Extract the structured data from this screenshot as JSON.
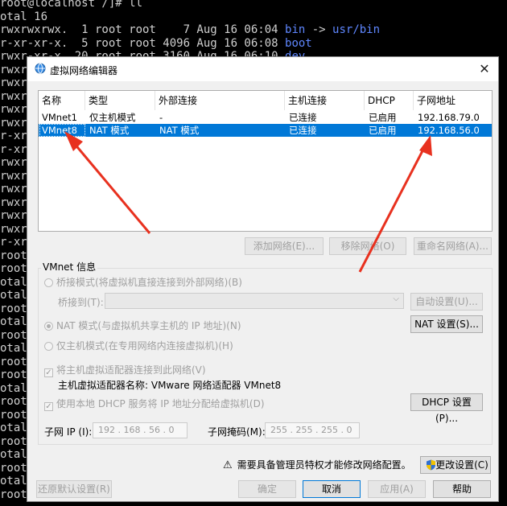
{
  "terminal": {
    "lines": [
      {
        "text": "root@localhost /]# ll"
      },
      {
        "text": "otal 16"
      },
      {
        "text": "rwxrwxrwx.  1 root root    7 Aug 16 06:04 ",
        "link": "bin",
        "arrow": " -> ",
        "target": "usr/bin"
      },
      {
        "text": "r-xr-xr-x.  5 root root 4096 Aug 16 06:08 ",
        "link": "boot"
      },
      {
        "text": "rwxr-xr-x. 20 root root 3160 Aug 16 06:10 ",
        "link": "dev"
      },
      {
        "text": "rwxr"
      },
      {
        "text": "rwxr"
      },
      {
        "text": "rwxr"
      },
      {
        "text": "rwxr"
      },
      {
        "text": "rwxr"
      },
      {
        "text": "r-xr"
      },
      {
        "text": "r-xr"
      },
      {
        "text": "rwxr"
      },
      {
        "text": "rwxr"
      },
      {
        "text": "rwxr"
      },
      {
        "text": "rwxrw"
      },
      {
        "text": "rwxr"
      },
      {
        "text": "rwxr"
      },
      {
        "text": "r-xr"
      },
      {
        "text": "root"
      },
      {
        "text": "root"
      },
      {
        "text": "otal"
      },
      {
        "text": "otal"
      },
      {
        "text": "root"
      },
      {
        "text": "otal"
      },
      {
        "text": "root"
      },
      {
        "text": "otal"
      },
      {
        "text": "root"
      },
      {
        "text": "root"
      },
      {
        "text": "otal"
      },
      {
        "text": "root"
      },
      {
        "text": "root"
      },
      {
        "text": "otal"
      },
      {
        "text": "root"
      },
      {
        "text": "otal"
      },
      {
        "text": "root"
      },
      {
        "text": "otal"
      },
      {
        "text": "root@localhost ~]#"
      }
    ]
  },
  "dialog": {
    "title": "虚拟网络编辑器",
    "close_glyph": "✕",
    "table": {
      "headers": [
        "名称",
        "类型",
        "外部连接",
        "主机连接",
        "DHCP",
        "子网地址"
      ],
      "rows": [
        [
          "VMnet1",
          "仅主机模式",
          "-",
          "已连接",
          "已启用",
          "192.168.79.0"
        ],
        [
          "VMnet8",
          "NAT 模式",
          "NAT 模式",
          "已连接",
          "已启用",
          "192.168.56.0"
        ]
      ],
      "selected_row": 1
    },
    "buttons": {
      "add_network": "添加网络(E)...",
      "remove_network": "移除网络(O)",
      "rename_network": "重命名网络(A)...",
      "auto_settings": "自动设置(U)...",
      "nat_settings": "NAT 设置(S)...",
      "dhcp_settings": "DHCP 设置(P)...",
      "change_settings": "更改设置(C)",
      "restore_defaults": "还原默认设置(R)",
      "ok": "确定",
      "cancel": "取消",
      "apply": "应用(A)",
      "help": "帮助"
    },
    "vmnet_info": {
      "label": "VMnet 信息",
      "bridge_mode": "桥接模式(将虚拟机直接连接到外部网络)(B)",
      "bridge_to_label": "桥接到(T):",
      "bridge_to_value": "",
      "nat_mode": "NAT 模式(与虚拟机共享主机的 IP 地址)(N)",
      "host_only_mode": "仅主机模式(在专用网络内连接虚拟机)(H)",
      "selected_mode": "nat",
      "connect_adapter": "将主机虚拟适配器连接到此网络(V)",
      "adapter_name_label": "主机虚拟适配器名称: VMware 网络适配器 VMnet8",
      "use_dhcp": "使用本地 DHCP 服务将 IP 地址分配给虚拟机(D)",
      "subnet_ip_label": "子网 IP (I):",
      "subnet_ip": "192 . 168 . 56 . 0",
      "subnet_mask_label": "子网掩码(M):",
      "subnet_mask": "255 . 255 . 255 . 0"
    },
    "admin_warning": "需要具备管理员特权才能修改网络配置。",
    "warning_glyph": "⚠"
  },
  "colors": {
    "selection": "#0078d7",
    "annotation_arrow": "#e8311f",
    "terminal_link": "#5f87ff"
  }
}
